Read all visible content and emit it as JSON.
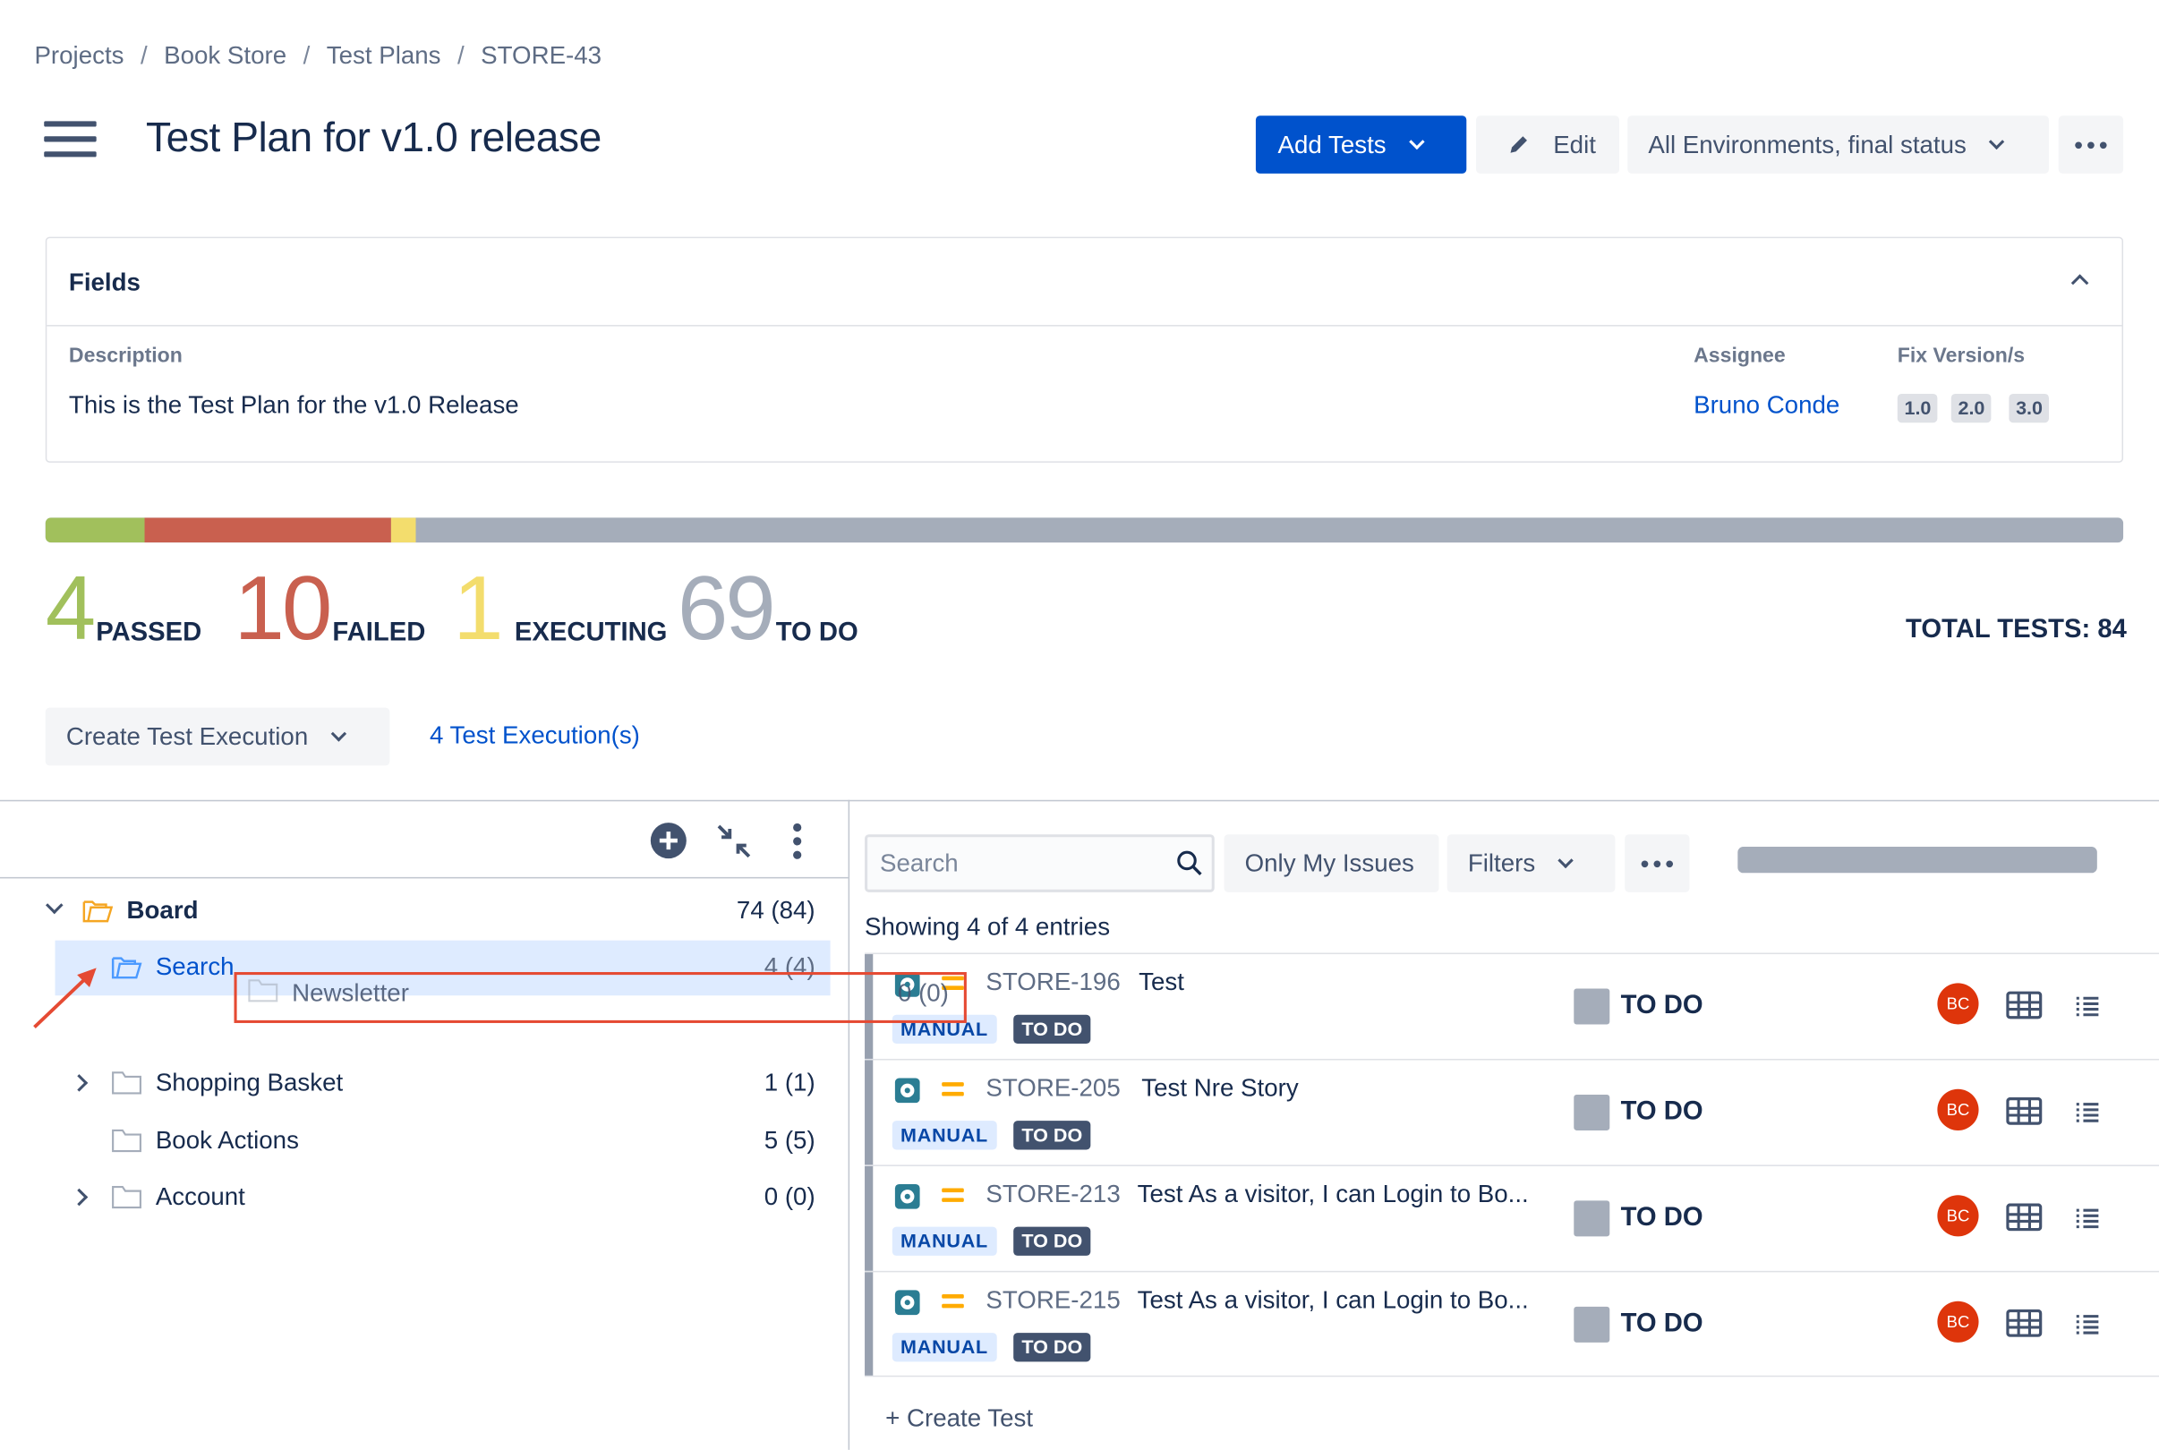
{
  "breadcrumb": [
    "Projects",
    "Book Store",
    "Test Plans",
    "STORE-43"
  ],
  "breadcrumb_separator": "/",
  "page": {
    "title": "Test Plan for v1.0 release"
  },
  "toolbar": {
    "add_tests_label": "Add Tests",
    "edit_label": "Edit",
    "environment_label": "All Environments, final status"
  },
  "fields": {
    "title": "Fields",
    "description_label": "Description",
    "description_value": "This is the Test Plan for the v1.0 Release",
    "assignee_label": "Assignee",
    "assignee_value": "Bruno Conde",
    "fix_version_label": "Fix Version/s",
    "fix_versions": [
      "1.0",
      "2.0",
      "3.0"
    ]
  },
  "progress": {
    "segments": [
      {
        "status": "PASSED",
        "count": 4,
        "color": "#a1c05c"
      },
      {
        "status": "FAILED",
        "count": 10,
        "color": "#c9604f"
      },
      {
        "status": "EXECUTING",
        "count": 1,
        "color": "#f3dd6d"
      },
      {
        "status": "TO DO",
        "count": 69,
        "color": "#a5adba"
      }
    ]
  },
  "stats": {
    "passed": {
      "count": "4",
      "label": "PASSED",
      "color": "#a1c05c"
    },
    "failed": {
      "count": "10",
      "label": "FAILED",
      "color": "#c9604f"
    },
    "executing": {
      "count": "1",
      "label": "EXECUTING",
      "color": "#f3dd6d"
    },
    "todo": {
      "count": "69",
      "label": "TO DO",
      "color": "#a5adba"
    },
    "total_label": "TOTAL TESTS: 84"
  },
  "executions": {
    "create_label": "Create Test Execution",
    "link_label": "4 Test Execution(s)"
  },
  "tree": {
    "root": {
      "label": "Board",
      "count": "74 (84)"
    },
    "items": [
      {
        "label": "Search",
        "count": "4 (4)"
      },
      {
        "label": "Shopping Basket",
        "count": "1 (1)"
      },
      {
        "label": "Book Actions",
        "count": "5 (5)"
      },
      {
        "label": "Account",
        "count": "0 (0)"
      }
    ],
    "dragging": {
      "label": "Newsletter",
      "count": "0 (0)"
    }
  },
  "tests_toolbar": {
    "search_placeholder": "Search",
    "only_my_issues_label": "Only My Issues",
    "filters_label": "Filters"
  },
  "tests": {
    "showing": "Showing 4 of 4 entries",
    "rows": [
      {
        "key": "STORE-196",
        "summary": "Test",
        "type": "MANUAL",
        "status_badge": "TO DO",
        "status": "TO DO",
        "avatar": "BC"
      },
      {
        "key": "STORE-205",
        "summary": "Test Nre Story",
        "type": "MANUAL",
        "status_badge": "TO DO",
        "status": "TO DO",
        "avatar": "BC"
      },
      {
        "key": "STORE-213",
        "summary": "Test As a visitor, I can Login to Bo...",
        "type": "MANUAL",
        "status_badge": "TO DO",
        "status": "TO DO",
        "avatar": "BC"
      },
      {
        "key": "STORE-215",
        "summary": "Test As a visitor, I can Login to Bo...",
        "type": "MANUAL",
        "status_badge": "TO DO",
        "status": "TO DO",
        "avatar": "BC"
      }
    ],
    "create_label": "+ Create Test"
  },
  "colors": {
    "primary": "#0052cc",
    "avatar": "#de350b",
    "highlight": "#e54a33",
    "test_type": "#2b7d93",
    "priority": "#ffab00"
  },
  "icons": {
    "menu": "hamburger-icon",
    "add": "plus-circle-icon",
    "collapse": "collapse-arrows-icon",
    "more": "vertical-dots-icon",
    "folder": "folder-icon",
    "search": "search-icon",
    "grid": "grid-icon",
    "list": "list-icon"
  }
}
